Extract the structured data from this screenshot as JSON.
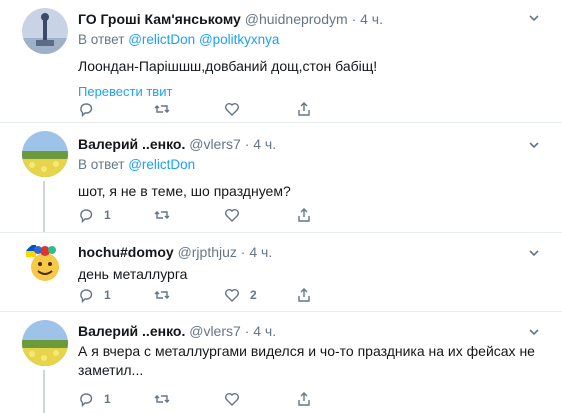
{
  "tweets": [
    {
      "name": "ГО Гроші Кам'янському",
      "handle": "@huidneprodym",
      "dot": "·",
      "time": "4 ч.",
      "replyto_prefix": "В ответ",
      "mentions": [
        "@relictDon",
        "@politkyxnya"
      ],
      "text": "Лоондан-Парішшш,довбаний дощ,стон бабіщ!",
      "translate": "Перевести твит",
      "reply_count": "",
      "like_count": ""
    },
    {
      "name": "Валерий ..енко.",
      "handle": "@vlers7",
      "dot": "·",
      "time": "4 ч.",
      "replyto_prefix": "В ответ",
      "mentions": [
        "@relictDon"
      ],
      "text": "шот, я не в теме, шо празднуем?",
      "reply_count": "1",
      "like_count": ""
    },
    {
      "name": "hochu#domoy",
      "handle": "@rjpthjuz",
      "dot": "·",
      "time": "4 ч.",
      "text": "день  металлурга",
      "reply_count": "1",
      "like_count": "2"
    },
    {
      "name": "Валерий ..енко.",
      "handle": "@vlers7",
      "dot": "·",
      "time": "4 ч.",
      "text": "А я вчера с металлургами виделся и чо-то праздника на их фейсах не заметил...",
      "reply_count": "1",
      "like_count": ""
    }
  ],
  "colors": {
    "accent": "#1da1f2",
    "muted": "#657786",
    "divider": "#e6ecf0",
    "thread": "#ccd6dd"
  }
}
